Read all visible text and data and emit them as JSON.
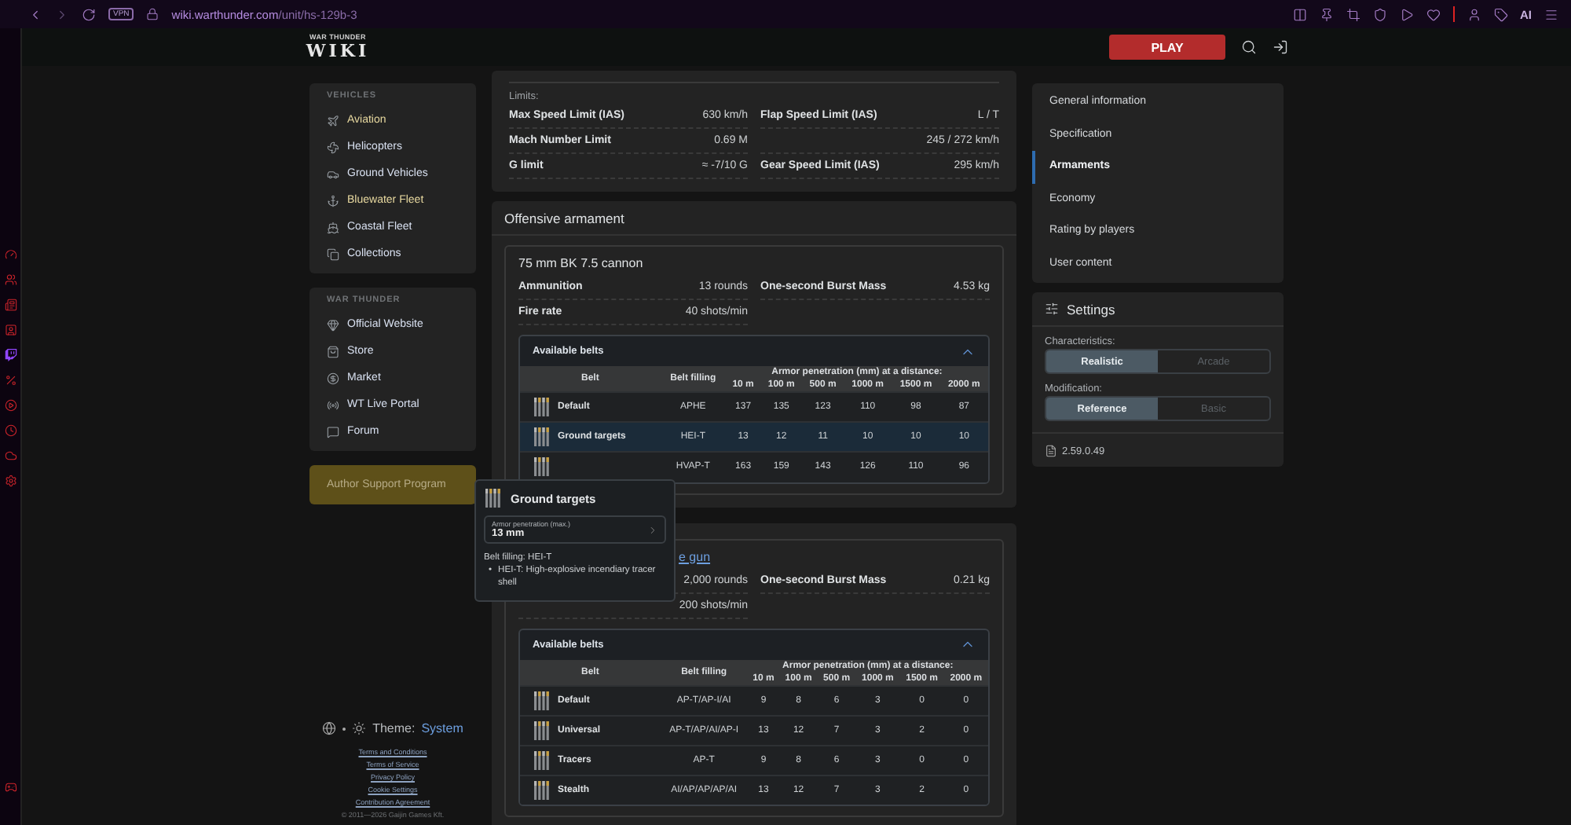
{
  "browser": {
    "vpn_badge": "VPN",
    "url_host": "wiki.warthunder.com",
    "url_path": "/unit/hs-129b-3",
    "ai_label": "AI"
  },
  "header": {
    "logo_top": "WAR THUNDER",
    "logo_main": "WIKI",
    "play_button": "PLAY"
  },
  "sidebar": {
    "sections": [
      {
        "heading": "VEHICLES",
        "items": [
          {
            "label": "Aviation",
            "color": "#e8d9a0"
          },
          {
            "label": "Helicopters",
            "color": "#d8e0f0"
          },
          {
            "label": "Ground Vehicles",
            "color": "#d8e0f0"
          },
          {
            "label": "Bluewater Fleet",
            "color": "#e8d9a0"
          },
          {
            "label": "Coastal Fleet",
            "color": "#d8e0f0"
          },
          {
            "label": "Collections",
            "color": "#d8e0f0"
          }
        ]
      },
      {
        "heading": "WAR THUNDER",
        "items": [
          {
            "label": "Official Website",
            "color": "#d8e0f0"
          },
          {
            "label": "Store",
            "color": "#d8e0f0"
          },
          {
            "label": "Market",
            "color": "#d8e0f0"
          },
          {
            "label": "WT Live Portal",
            "color": "#d8e0f0"
          },
          {
            "label": "Forum",
            "color": "#d8e0f0"
          }
        ]
      }
    ],
    "author_button": "Author Support Program",
    "theme_label": "Theme:",
    "theme_value": "System",
    "footer_links": [
      "Terms and Conditions",
      "Terms of Service",
      "Privacy Policy",
      "Cookie Settings",
      "Contribution Agreement"
    ],
    "copyright": "© 2011—2026 Gaijin Games Kft."
  },
  "limits": {
    "heading": "Limits:",
    "cells": [
      {
        "label": "Max Speed Limit (IAS)",
        "value": "630 km/h"
      },
      {
        "label": "Flap Speed Limit (IAS)",
        "value": "L / T"
      },
      {
        "label": "Mach Number Limit",
        "value": "0.69 M"
      },
      {
        "value": "245 / 272 km/h"
      },
      {
        "label": "G limit",
        "value": "≈ -7/10 G"
      },
      {
        "label": "Gear Speed Limit (IAS)",
        "value": "295 km/h"
      }
    ]
  },
  "armament": {
    "title": "Offensive armament",
    "weapons": [
      {
        "title": "75 mm BK 7.5 cannon",
        "title_partly_hidden": false,
        "stats": [
          {
            "label": "Ammunition",
            "value": "13 rounds"
          },
          {
            "label": "One-second Burst Mass",
            "value": "4.53 kg"
          },
          {
            "label": "Fire rate",
            "value": "40 shots/min"
          }
        ],
        "belts": {
          "title": "Available belts",
          "expanded": true,
          "col_belt": "Belt",
          "col_filling": "Belt filling",
          "col_penetration": "Armor penetration (mm) at a distance:",
          "distances": [
            "10 m",
            "100 m",
            "500 m",
            "1000 m",
            "1500 m",
            "2000 m"
          ],
          "rows": [
            {
              "name": "Default",
              "filling": "APHE",
              "values": [
                "137",
                "135",
                "123",
                "110",
                "98",
                "87"
              ],
              "selected": false
            },
            {
              "name": "Ground targets",
              "filling": "HEI-T",
              "values": [
                "13",
                "12",
                "11",
                "10",
                "10",
                "10"
              ],
              "selected": true
            },
            {
              "name": "",
              "filling": "HVAP-T",
              "values": [
                "163",
                "159",
                "143",
                "126",
                "110",
                "96"
              ],
              "selected": false
            }
          ]
        }
      },
      {
        "title": "e gun",
        "title_partly_hidden": true,
        "stats": [
          {
            "value": "2,000 rounds"
          },
          {
            "label": "One-second Burst Mass",
            "value": "0.21 kg"
          },
          {
            "value": "200 shots/min"
          }
        ],
        "belts": {
          "title": "Available belts",
          "expanded": true,
          "col_belt": "Belt",
          "col_filling": "Belt filling",
          "col_penetration": "Armor penetration (mm) at a distance:",
          "distances": [
            "10 m",
            "100 m",
            "500 m",
            "1000 m",
            "1500 m",
            "2000 m"
          ],
          "rows": [
            {
              "name": "Default",
              "filling": "AP-T/AP-I/AI",
              "values": [
                "9",
                "8",
                "6",
                "3",
                "0",
                "0"
              ],
              "selected": false
            },
            {
              "name": "Universal",
              "filling": "AP-T/AP/AI/AP-I",
              "values": [
                "13",
                "12",
                "7",
                "3",
                "2",
                "0"
              ],
              "selected": false
            },
            {
              "name": "Tracers",
              "filling": "AP-T",
              "values": [
                "9",
                "8",
                "6",
                "3",
                "0",
                "0"
              ],
              "selected": false
            },
            {
              "name": "Stealth",
              "filling": "AI/AP/AP/AP/AI",
              "values": [
                "13",
                "12",
                "7",
                "3",
                "2",
                "0"
              ],
              "selected": false
            }
          ]
        }
      }
    ]
  },
  "tooltip": {
    "title": "Ground targets",
    "stat_label": "Armor penetration (max.)",
    "stat_value": "13 mm",
    "filling_label": "Belt filling: HEI-T",
    "bullets": [
      {
        "marker": "•",
        "text": "HEI-T: High-explosive incendiary tracer shell"
      }
    ]
  },
  "page_nav": {
    "items": [
      {
        "label": "General information",
        "selected": false
      },
      {
        "label": "Specification",
        "selected": false
      },
      {
        "label": "Armaments",
        "selected": true
      },
      {
        "label": "Economy",
        "selected": false
      },
      {
        "label": "Rating by players",
        "selected": false
      },
      {
        "label": "User content",
        "selected": false
      }
    ]
  },
  "settings": {
    "title": "Settings",
    "groups": [
      {
        "label": "Characteristics:",
        "options": [
          {
            "label": "Realistic",
            "selected": true
          },
          {
            "label": "Arcade",
            "selected": false
          }
        ]
      },
      {
        "label": "Modification:",
        "options": [
          {
            "label": "Reference",
            "selected": true
          },
          {
            "label": "Basic",
            "selected": false
          }
        ]
      }
    ],
    "version": "2.59.0.49"
  }
}
